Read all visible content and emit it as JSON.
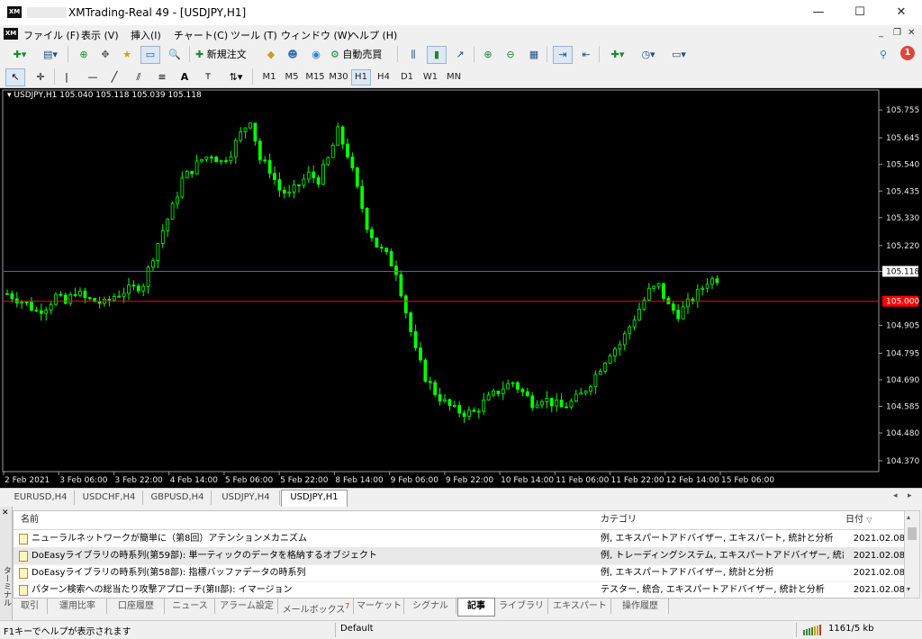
{
  "window": {
    "title": "XMTrading-Real 49 - [USDJPY,H1]",
    "app_icon": "XM",
    "controls": {
      "minimize": "—",
      "maximize": "☐",
      "close": "✕"
    }
  },
  "menu": [
    "ファイル (F)",
    "表示 (V)",
    "挿入(I)",
    "チャート(C)",
    "ツール (T)",
    "ウィンドウ (W)",
    "ヘルプ (H)"
  ],
  "mdi_controls": {
    "minimize": "_",
    "restore": "❐",
    "close": "✕"
  },
  "toolbar": {
    "new_order": "新規注文",
    "auto_trade": "自動売買",
    "notification_count": "1"
  },
  "drawing_tools": {
    "text_tool": "A",
    "label_tool": "T"
  },
  "timeframes": [
    "M1",
    "M5",
    "M15",
    "M30",
    "H1",
    "H4",
    "D1",
    "W1",
    "MN"
  ],
  "timeframe_active": "H1",
  "chart_data": {
    "type": "candlestick",
    "symbol_label": "USDJPY,H1  105.040 105.118 105.039 105.118",
    "y_ticks": [
      "105.755",
      "105.645",
      "105.540",
      "105.435",
      "105.330",
      "105.220",
      "105.118",
      "104.905",
      "104.795",
      "104.690",
      "104.585",
      "104.480",
      "104.370"
    ],
    "ylim": [
      104.37,
      105.77
    ],
    "x_ticks": [
      "2 Feb 2021",
      "3 Feb 06:00",
      "3 Feb 22:00",
      "4 Feb 14:00",
      "5 Feb 06:00",
      "5 Feb 22:00",
      "8 Feb 14:00",
      "9 Feb 06:00",
      "9 Feb 22:00",
      "10 Feb 14:00",
      "11 Feb 06:00",
      "11 Feb 22:00",
      "12 Feb 14:00",
      "15 Feb 06:00"
    ],
    "bid_line": 105.118,
    "ask_line": 105.0,
    "ask_label": "105.000",
    "close_path": [
      [
        0,
        105.03
      ],
      [
        8,
        105.01
      ],
      [
        16,
        104.99
      ],
      [
        24,
        104.96
      ],
      [
        32,
        104.98
      ],
      [
        40,
        105.02
      ],
      [
        48,
        104.99
      ],
      [
        56,
        105.04
      ],
      [
        64,
        105.01
      ],
      [
        72,
        105.0
      ],
      [
        80,
        104.99
      ],
      [
        88,
        105.02
      ],
      [
        96,
        105.04
      ],
      [
        104,
        105.05
      ],
      [
        112,
        105.07
      ],
      [
        120,
        105.18
      ],
      [
        128,
        105.28
      ],
      [
        136,
        105.37
      ],
      [
        144,
        105.48
      ],
      [
        152,
        105.52
      ],
      [
        160,
        105.56
      ],
      [
        168,
        105.58
      ],
      [
        176,
        105.55
      ],
      [
        184,
        105.59
      ],
      [
        192,
        105.66
      ],
      [
        200,
        105.72
      ],
      [
        208,
        105.56
      ],
      [
        216,
        105.52
      ],
      [
        224,
        105.44
      ],
      [
        232,
        105.42
      ],
      [
        240,
        105.46
      ],
      [
        248,
        105.5
      ],
      [
        256,
        105.48
      ],
      [
        264,
        105.56
      ],
      [
        272,
        105.67
      ],
      [
        280,
        105.58
      ],
      [
        288,
        105.44
      ],
      [
        296,
        105.3
      ],
      [
        304,
        105.22
      ],
      [
        312,
        105.18
      ],
      [
        320,
        105.12
      ],
      [
        328,
        104.96
      ],
      [
        336,
        104.8
      ],
      [
        344,
        104.7
      ],
      [
        352,
        104.64
      ],
      [
        360,
        104.6
      ],
      [
        368,
        104.57
      ],
      [
        376,
        104.56
      ],
      [
        384,
        104.56
      ],
      [
        392,
        104.6
      ],
      [
        400,
        104.63
      ],
      [
        408,
        104.66
      ],
      [
        416,
        104.68
      ],
      [
        424,
        104.64
      ],
      [
        432,
        104.6
      ],
      [
        440,
        104.62
      ],
      [
        448,
        104.6
      ],
      [
        456,
        104.58
      ],
      [
        464,
        104.6
      ],
      [
        472,
        104.63
      ],
      [
        480,
        104.68
      ],
      [
        488,
        104.74
      ],
      [
        496,
        104.8
      ],
      [
        504,
        104.83
      ],
      [
        512,
        104.9
      ],
      [
        520,
        104.97
      ],
      [
        528,
        105.04
      ],
      [
        536,
        105.06
      ],
      [
        544,
        104.98
      ],
      [
        552,
        104.95
      ],
      [
        560,
        104.99
      ],
      [
        568,
        105.03
      ],
      [
        576,
        105.08
      ],
      [
        584,
        105.09
      ]
    ]
  },
  "symbol_tabs": [
    "EURUSD,H4",
    "USDCHF,H4",
    "GBPUSD,H4",
    "USDJPY,H4",
    "USDJPY,H1"
  ],
  "symbol_tab_active": "USDJPY,H1",
  "terminal": {
    "side_label": "ターミナル",
    "columns": {
      "name": "名前",
      "category": "カテゴリ",
      "date": "日付"
    },
    "articles": [
      {
        "name": "ニューラルネットワークが簡単に（第8回）アテンションメカニズム",
        "category": "例, エキスパートアドバイザー, エキスパート, 統計と分析",
        "date": "2021.02.08"
      },
      {
        "name": "DoEasyライブラリの時系列(第59部): 単一ティックのデータを格納するオブジェクト",
        "category": "例, トレーディングシステム, エキスパートアドバイザー, 統計と分析",
        "date": "2021.02.08"
      },
      {
        "name": "DoEasyライブラリの時系列(第58部): 指標バッファデータの時系列",
        "category": "例, エキスパートアドバイザー, 統計と分析",
        "date": "2021.02.08"
      },
      {
        "name": "パターン検索への総当たり攻撃アプローチ(第II部): イマージョン",
        "category": "テスター, 統合, エキスパートアドバイザー, 統計と分析",
        "date": "2021.02.08"
      }
    ],
    "bottom_tabs": [
      "取引",
      "運用比率",
      "口座履歴",
      "ニュース",
      "アラーム設定",
      "メールボックス",
      "マーケット",
      "シグナル",
      "記事",
      "ライブラリ",
      "エキスパート",
      "操作履歴"
    ],
    "mailbox_badge": "7",
    "active_tab": "記事"
  },
  "status": {
    "help": "F1キーでヘルプが表示されます",
    "profile": "Default",
    "traffic": "1161/5 kb"
  },
  "colors": {
    "candle": "#00ff00",
    "bid_line": "#5a6a8a",
    "ask_line": "#ff0000",
    "chart_bg": "#000000"
  }
}
